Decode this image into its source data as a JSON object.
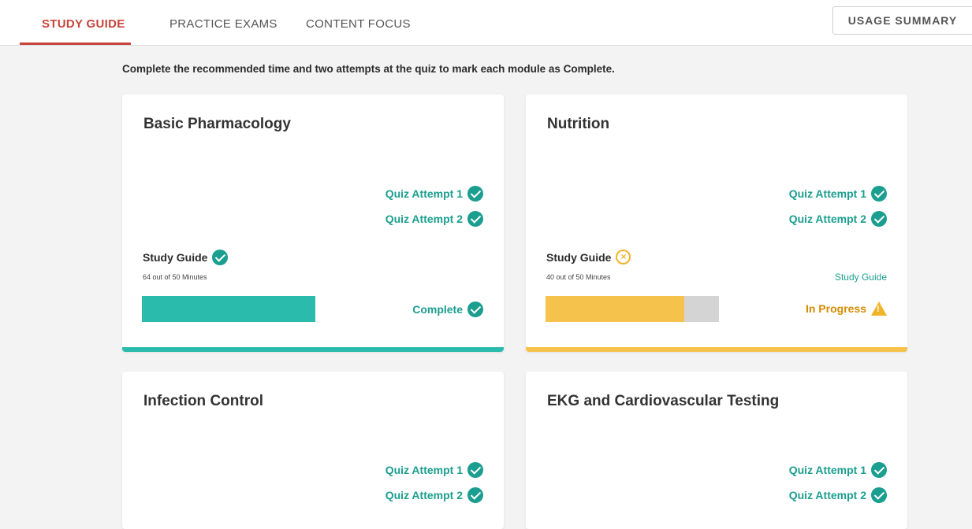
{
  "tabs": [
    {
      "label": "STUDY GUIDE",
      "active": true
    },
    {
      "label": "PRACTICE EXAMS",
      "active": false
    },
    {
      "label": "CONTENT FOCUS",
      "active": false
    }
  ],
  "usage_button": "USAGE SUMMARY",
  "instructions": "Complete the recommended time and two attempts at the quiz to mark each module as Complete.",
  "colors": {
    "accent": "#c8443a",
    "teal": "#1a9e8f",
    "teal_bar": "#2bbbad",
    "amber": "#f0b429",
    "amber_text": "#d48a00"
  },
  "cards": [
    {
      "title": "Basic Pharmacology",
      "quiz1": "Quiz Attempt 1",
      "quiz2": "Quiz Attempt 2",
      "study_label": "Study Guide",
      "study_status_icon": "check-circle-icon",
      "minutes": "64 out of 50 Minutes",
      "progress": 1.0,
      "status": "Complete",
      "status_icon": "check-circle-icon"
    },
    {
      "title": "Nutrition",
      "quiz1": "Quiz Attempt 1",
      "quiz2": "Quiz Attempt 2",
      "study_label": "Study Guide",
      "study_status_icon": "x-circle-icon",
      "minutes": "40 out of 50 Minutes",
      "study_link": "Study Guide",
      "progress": 0.8,
      "status": "In Progress",
      "status_icon": "warning-icon"
    },
    {
      "title": "Infection Control",
      "quiz1": "Quiz Attempt 1",
      "quiz2": "Quiz Attempt 2"
    },
    {
      "title": "EKG and Cardiovascular Testing",
      "quiz1": "Quiz Attempt 1",
      "quiz2": "Quiz Attempt 2"
    }
  ]
}
